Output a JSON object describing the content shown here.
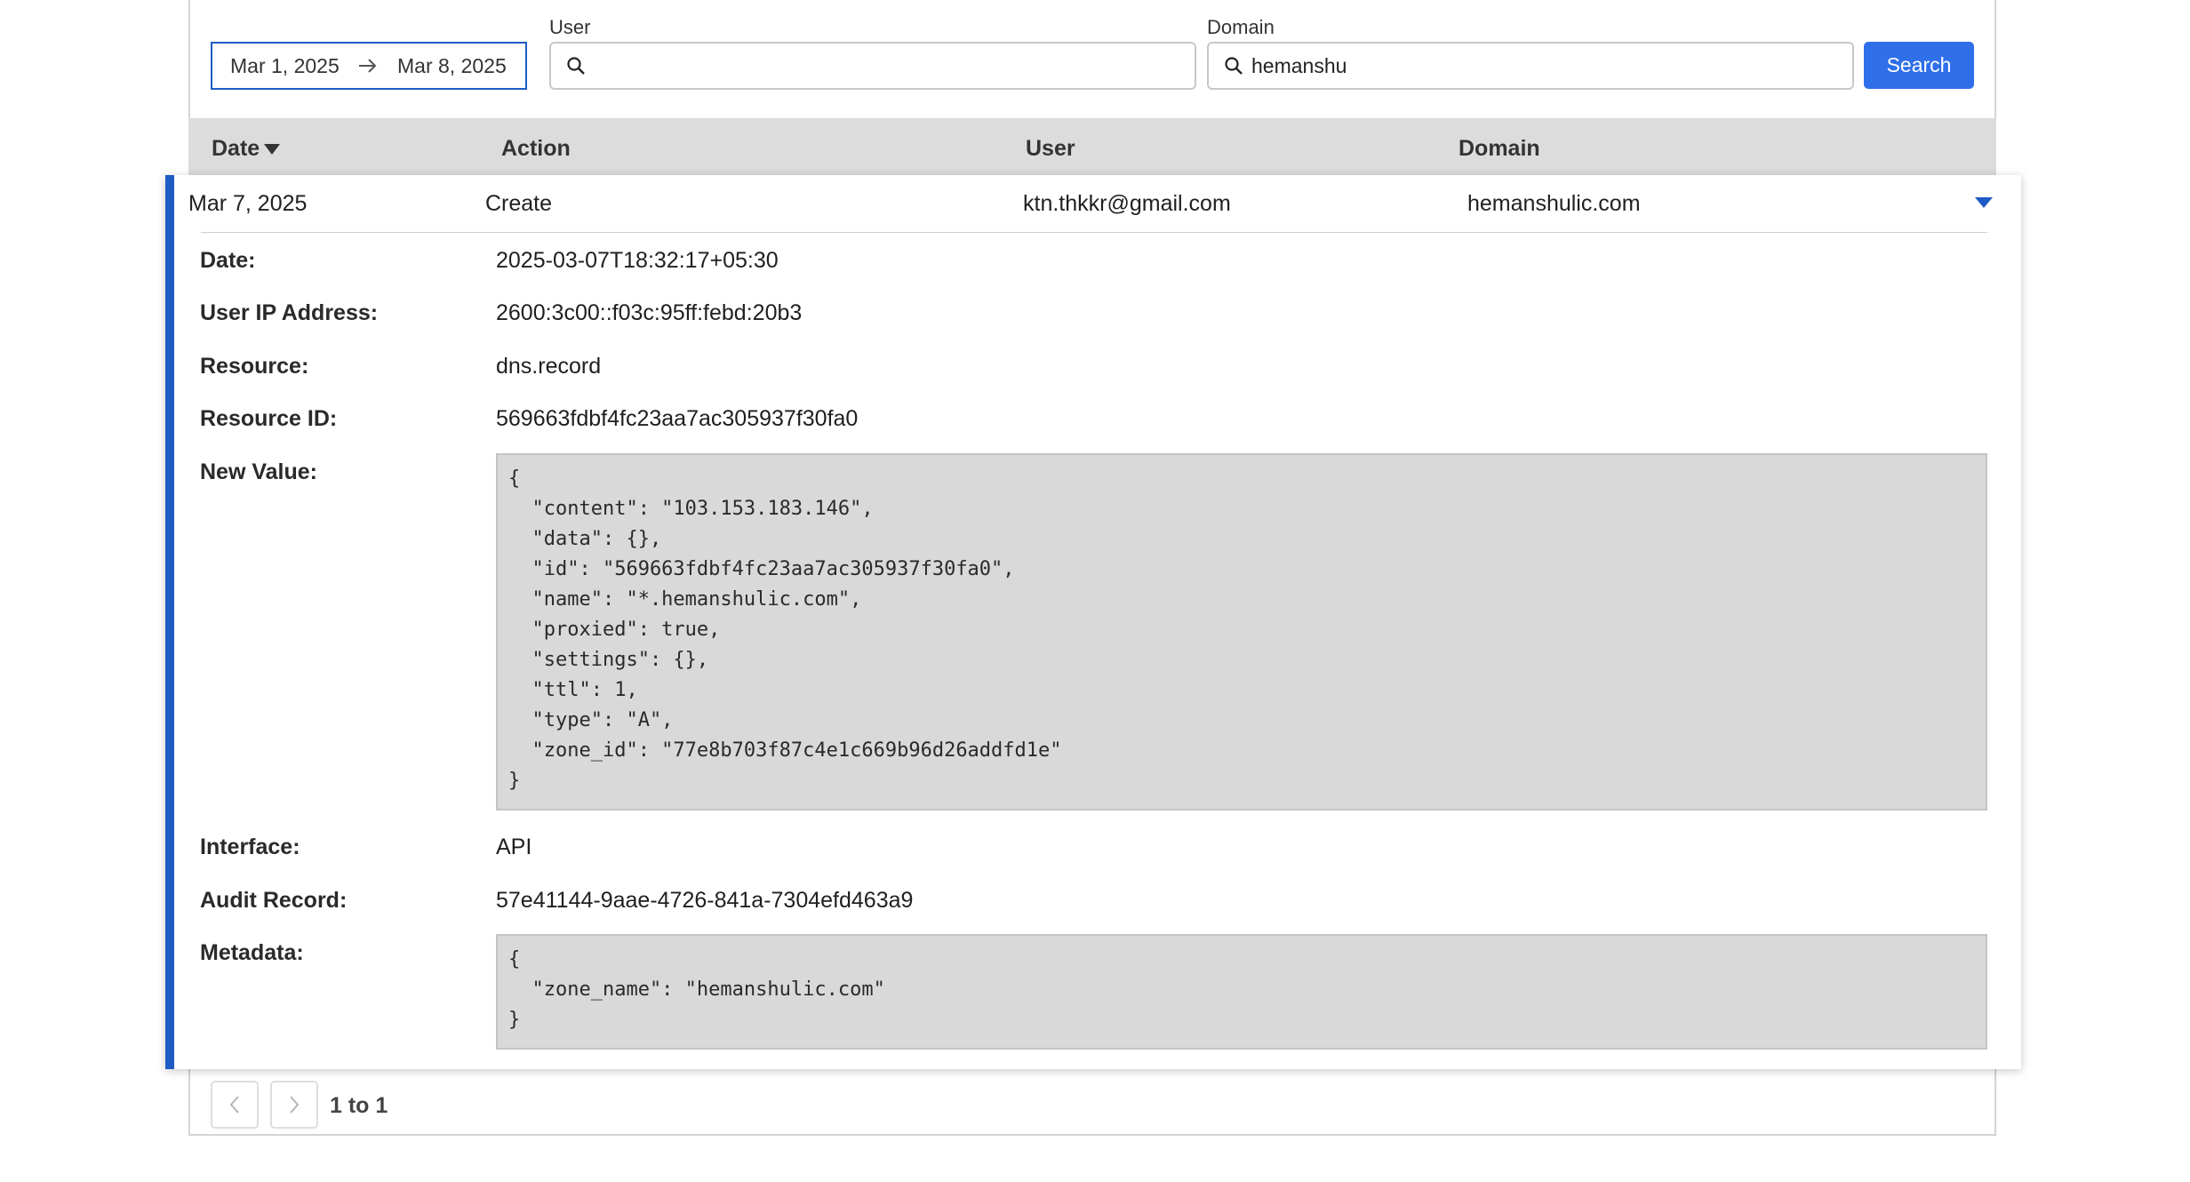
{
  "filters": {
    "date_range": {
      "start": "Mar 1, 2025",
      "end": "Mar 8, 2025"
    },
    "user": {
      "label": "User",
      "value": ""
    },
    "domain": {
      "label": "Domain",
      "value": "hemanshu"
    },
    "search_label": "Search"
  },
  "table": {
    "headers": {
      "date": "Date",
      "action": "Action",
      "user": "User",
      "domain": "Domain"
    },
    "row": {
      "date": "Mar 7, 2025",
      "action": "Create",
      "user": "ktn.thkkr@gmail.com",
      "domain": "hemanshulic.com"
    }
  },
  "details": {
    "date_label": "Date:",
    "date": "2025-03-07T18:32:17+05:30",
    "ip_label": "User IP Address:",
    "ip": "2600:3c00::f03c:95ff:febd:20b3",
    "resource_label": "Resource:",
    "resource": "dns.record",
    "resource_id_label": "Resource ID:",
    "resource_id": "569663fdbf4fc23aa7ac305937f30fa0",
    "new_value_label": "New Value:",
    "new_value": "{\n  \"content\": \"103.153.183.146\",\n  \"data\": {},\n  \"id\": \"569663fdbf4fc23aa7ac305937f30fa0\",\n  \"name\": \"*.hemanshulic.com\",\n  \"proxied\": true,\n  \"settings\": {},\n  \"ttl\": 1,\n  \"type\": \"A\",\n  \"zone_id\": \"77e8b703f87c4e1c669b96d26addfd1e\"\n}",
    "interface_label": "Interface:",
    "interface": "API",
    "audit_label": "Audit Record:",
    "audit": "57e41144-9aae-4726-841a-7304efd463a9",
    "metadata_label": "Metadata:",
    "metadata": "{\n  \"zone_name\": \"hemanshulic.com\"\n}"
  },
  "pagination": {
    "text": "1 to 1"
  },
  "icons": {
    "search": "search-icon",
    "arrow": "arrow-right-icon",
    "sort": "sort-down-icon",
    "expand": "chevron-down-icon",
    "prev": "chevron-left-icon",
    "next": "chevron-right-icon"
  },
  "colors": {
    "accent": "#1f5bc4",
    "button": "#2f6fe9",
    "header_bg": "#dcdcdc",
    "code_bg": "#d9d9d9"
  }
}
